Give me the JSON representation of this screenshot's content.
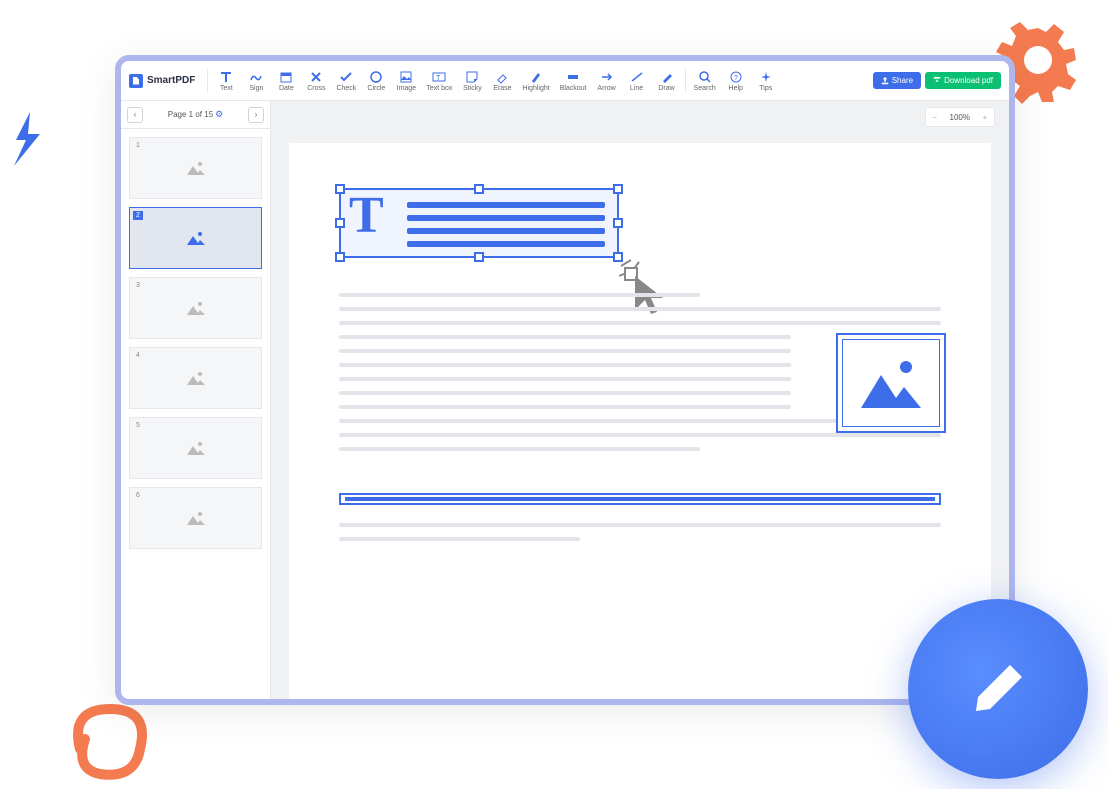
{
  "app": {
    "name": "SmartPDF"
  },
  "toolbar": {
    "tools": [
      {
        "label": "Text",
        "icon": "text"
      },
      {
        "label": "Sign",
        "icon": "sign"
      },
      {
        "label": "Date",
        "icon": "date"
      },
      {
        "label": "Cross",
        "icon": "cross"
      },
      {
        "label": "Check",
        "icon": "check"
      },
      {
        "label": "Circle",
        "icon": "circle"
      },
      {
        "label": "Image",
        "icon": "image"
      },
      {
        "label": "Text box",
        "icon": "textbox"
      },
      {
        "label": "Sticky",
        "icon": "sticky"
      },
      {
        "label": "Erase",
        "icon": "erase"
      },
      {
        "label": "Highlight",
        "icon": "highlight"
      },
      {
        "label": "Blackout",
        "icon": "blackout"
      },
      {
        "label": "Arrow",
        "icon": "arrow"
      },
      {
        "label": "Line",
        "icon": "line"
      },
      {
        "label": "Draw",
        "icon": "draw"
      }
    ],
    "help_tools": [
      {
        "label": "Search",
        "icon": "search"
      },
      {
        "label": "Help",
        "icon": "help"
      },
      {
        "label": "Tips",
        "icon": "tips"
      }
    ],
    "share": "Share",
    "download": "Download pdf"
  },
  "pagenav": {
    "label": "Page 1 of 15"
  },
  "zoom": {
    "value": "100%"
  },
  "thumbs": [
    "1",
    "2",
    "3",
    "4",
    "5",
    "6"
  ],
  "active_thumb": 1
}
